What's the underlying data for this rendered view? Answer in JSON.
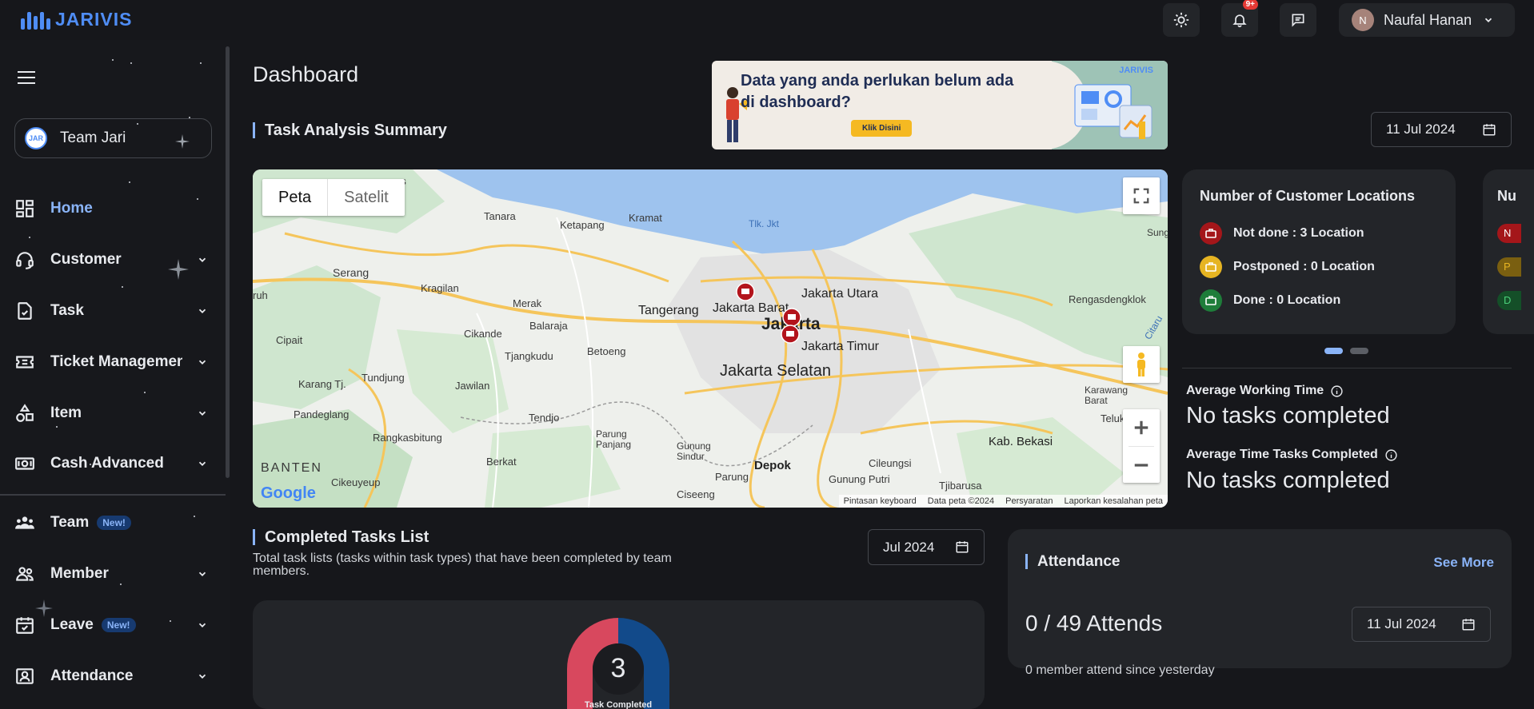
{
  "app": {
    "brand": "JARIVIS"
  },
  "header": {
    "notification_count": "9+",
    "user": {
      "initial": "N",
      "name": "Naufal Hanan"
    }
  },
  "sidebar": {
    "team": {
      "avatar_text": "JAR",
      "name": "Team Jari"
    },
    "items": [
      {
        "label": "Home",
        "icon": "home-grid-icon",
        "active": true
      },
      {
        "label": "Customer",
        "icon": "customer-headset-icon"
      },
      {
        "label": "Task",
        "icon": "task-check-icon"
      },
      {
        "label": "Ticket Management",
        "icon": "ticket-icon"
      },
      {
        "label": "Item",
        "icon": "item-shapes-icon"
      },
      {
        "label": "Cash Advanced",
        "icon": "cash-icon"
      },
      {
        "label": "Team",
        "icon": "team-icon",
        "badge": "New!"
      },
      {
        "label": "Member",
        "icon": "member-icon"
      },
      {
        "label": "Leave",
        "icon": "leave-calendar-icon",
        "badge": "New!"
      },
      {
        "label": "Attendance",
        "icon": "attendance-icon"
      }
    ]
  },
  "main": {
    "title": "Dashboard",
    "task_summary_title": "Task Analysis Summary",
    "summary_date": "11 Jul 2024",
    "banner": {
      "brand": "JARIVIS",
      "line1": "Data yang anda perlukan belum ada",
      "line2": "di dashboard?",
      "button": "Klik Disini"
    },
    "map": {
      "tabs": [
        "Peta",
        "Satelit"
      ],
      "labels": {
        "bay": "Tlk. Jkt",
        "tangerang": "Tangerang",
        "jakarta_barat": "Jakarta Barat",
        "jakarta": "Jakarta",
        "jakarta_utara": "Jakarta Utara",
        "jakarta_timur": "Jakarta Timur",
        "jakarta_selatan": "Jakarta Selatan",
        "depok": "Depok",
        "kab_bekasi": "Kab. Bekasi",
        "banten": "BANTEN",
        "serang": "Serang",
        "kragilan": "Kragilan",
        "merak": "Merak",
        "balaraja": "Balaraja",
        "cikande": "Cikande",
        "cipait": "Cipait",
        "tjangkudu": "Tjangkudu",
        "betoeng": "Betoeng",
        "tanara": "Tanara",
        "ketapang": "Ketapang",
        "kramat": "Kramat",
        "pomas": "omas",
        "karang_tj": "Karang Tj.",
        "tundjung": "Tundjung",
        "jawilan": "Jawilan",
        "pandeglang": "Pandeglang",
        "rangkasbitung": "Rangkasbitung",
        "tendjo": "Tendjo",
        "parung_panjang": "Parung\nPanjang",
        "gunung_sindur": "Gunung\nSindur",
        "parung": "Parung",
        "berkat": "Berkat",
        "cikeuyeup": "Cikeuyeup",
        "ciseeng": "Ciseeng",
        "gunung_putri": "Gunung Putri",
        "cileungsi": "Cileungsi",
        "tjibarusa": "Tjibarusa",
        "rengasdengklok": "Rengasdengklok",
        "karawang_barat": "Karawang\nBarat",
        "telukjam": "Telukjam",
        "sung": "Sung",
        "ruh": "ruh",
        "citarum": "Citaru"
      },
      "footer": [
        "Pintasan keyboard",
        "Data peta ©2024",
        "Persyaratan",
        "Laporkan kesalahan peta"
      ],
      "logo": "Google"
    },
    "customer_locations": {
      "title": "Number of Customer Locations",
      "rows": [
        {
          "label": "Not done : 3 Location",
          "color": "#a4161a"
        },
        {
          "label": "Postponed : 0 Location",
          "color": "#e6b422"
        },
        {
          "label": "Done : 0 Location",
          "color": "#1e7d3a"
        }
      ],
      "second_card": {
        "title": "Nu",
        "rows": [
          "N",
          "P",
          "D"
        ]
      }
    },
    "avg_working_time": {
      "label": "Average Working Time",
      "value": "No tasks completed"
    },
    "avg_time_completed": {
      "label": "Average Time Tasks Completed",
      "value": "No tasks completed"
    },
    "completed_tasks": {
      "title": "Completed Tasks List",
      "description": "Total task lists (tasks within task types) that have been completed by team members.",
      "month": "Jul 2024",
      "donut_value": "3",
      "donut_label": "Task Completed"
    },
    "attendance": {
      "title": "Attendance",
      "see_more": "See More",
      "count": "0 / 49 Attends",
      "date": "11 Jul 2024",
      "subtitle": "0 member attend since yesterday"
    }
  },
  "colors": {
    "accent": "#8ab4f8",
    "brand": "#4f8df5",
    "card": "#232529",
    "bg": "#16171b"
  }
}
